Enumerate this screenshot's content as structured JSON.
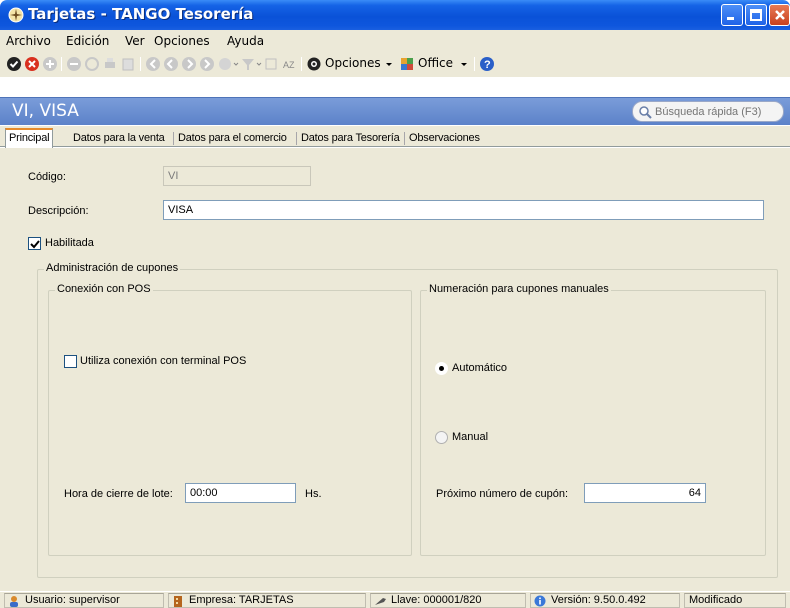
{
  "window": {
    "title": "Tarjetas - TANGO Tesorería"
  },
  "menu": {
    "items": [
      {
        "label": "Archivo"
      },
      {
        "label": "Edición"
      },
      {
        "label": "Ver"
      },
      {
        "label": "Opciones"
      },
      {
        "label": "Ayuda"
      }
    ]
  },
  "toolbar": {
    "options_label": "Opciones",
    "office_label": "Office"
  },
  "record": {
    "title": "VI, VISA"
  },
  "search": {
    "placeholder": "Búsqueda rápida (F3)"
  },
  "tabs": [
    {
      "label": "Principal",
      "active": true
    },
    {
      "label": "Datos para la venta"
    },
    {
      "label": "Datos para el comercio"
    },
    {
      "label": "Datos para Tesorería"
    },
    {
      "label": "Observaciones"
    }
  ],
  "form": {
    "codigo_label": "Código:",
    "codigo_value": "VI",
    "descripcion_label": "Descripción:",
    "descripcion_value": "VISA",
    "habilitada_label": "Habilitada",
    "habilitada_checked": true,
    "admin_group": "Administración de cupones",
    "pos_group": "Conexión con POS",
    "pos_checkbox_label": "Utiliza conexión con terminal POS",
    "pos_checked": false,
    "hora_label": "Hora de cierre de lote:",
    "hora_value": "00:00",
    "hora_unit": "Hs.",
    "numeracion_group": "Numeración para cupones manuales",
    "radio_auto_label": "Automático",
    "radio_manual_label": "Manual",
    "selected_numbering": "Automático",
    "proximo_label": "Próximo número de cupón:",
    "proximo_value": "64"
  },
  "status": {
    "usuario": "Usuario: supervisor",
    "empresa": "Empresa: TARJETAS",
    "llave": "Llave: 000001/820",
    "version": "Versión: 9.50.0.492",
    "estado": "Modificado"
  }
}
